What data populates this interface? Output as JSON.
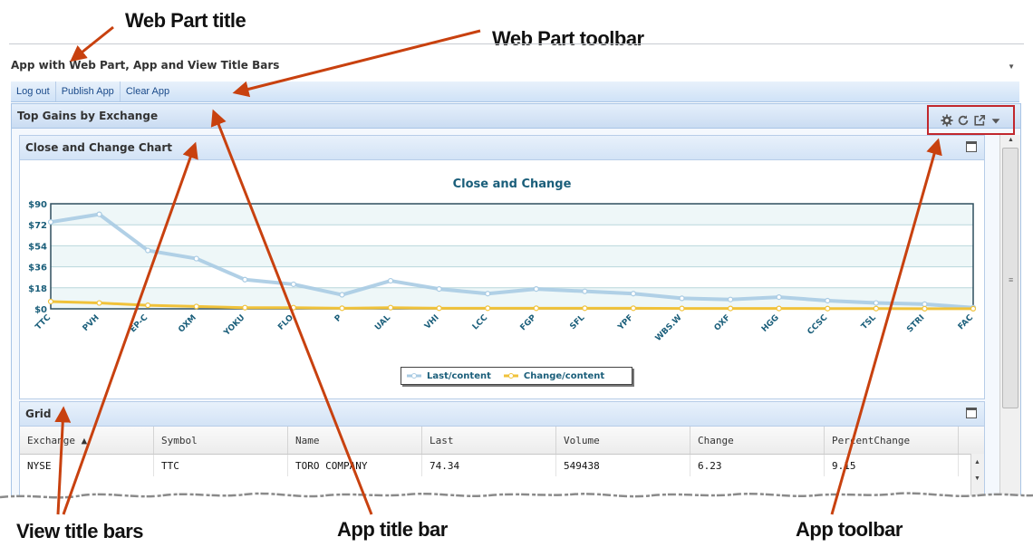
{
  "annotations": {
    "web_part_title": "Web Part title",
    "web_part_toolbar": "Web Part toolbar",
    "view_title_bars": "View title bars",
    "app_title_bar": "App title bar",
    "app_toolbar": "App toolbar"
  },
  "web_part": {
    "title": "App with Web Part, App and View Title Bars",
    "menu_icon": "chevron-down-icon",
    "toolbar": [
      "Log out",
      "Publish App",
      "Clear App"
    ]
  },
  "app": {
    "title": "Top Gains by Exchange",
    "toolbar_icons": [
      "gear-icon",
      "refresh-icon",
      "popout-icon",
      "chevron-down-icon"
    ]
  },
  "chart_view": {
    "title": "Close and Change Chart",
    "icon": "maximize-icon"
  },
  "chart_data": {
    "type": "line",
    "title": "Close and Change",
    "categories": [
      "TTC",
      "PVH",
      "EP-C",
      "OXM",
      "YOKU",
      "FLO",
      "P",
      "UAL",
      "VHI",
      "LCC",
      "FGP",
      "SFL",
      "YPF",
      "WBS.W",
      "OXF",
      "HGG",
      "CCSC",
      "TSL",
      "STRI",
      "FAC"
    ],
    "series": [
      {
        "name": "Last/content",
        "color": "#a9cbe3",
        "values": [
          74.34,
          81,
          50,
          43,
          25,
          21,
          12,
          24,
          17,
          13,
          17,
          15,
          13,
          9,
          8,
          10,
          7,
          5,
          4,
          1
        ]
      },
      {
        "name": "Change/content",
        "color": "#f0c23a",
        "values": [
          6.23,
          5,
          3,
          2,
          1,
          1,
          0.5,
          1,
          0.5,
          0.5,
          0.5,
          0.5,
          0.5,
          0.3,
          0.3,
          0.3,
          0.2,
          0.2,
          0.1,
          0.1
        ]
      }
    ],
    "y_ticks": [
      "$90",
      "$72",
      "$54",
      "$36",
      "$18",
      "$0"
    ],
    "ylim": [
      0,
      90
    ],
    "legend": "bottom-center",
    "grid": true
  },
  "grid_view": {
    "title": "Grid",
    "icon": "maximize-icon",
    "columns": [
      "Exchange ▲",
      "Symbol",
      "Name",
      "Last",
      "Volume",
      "Change",
      "PercentChange"
    ],
    "rows": [
      [
        "NYSE",
        "TTC",
        "TORO COMPANY",
        "74.34",
        "549438",
        "6.23",
        "9.15"
      ]
    ]
  }
}
